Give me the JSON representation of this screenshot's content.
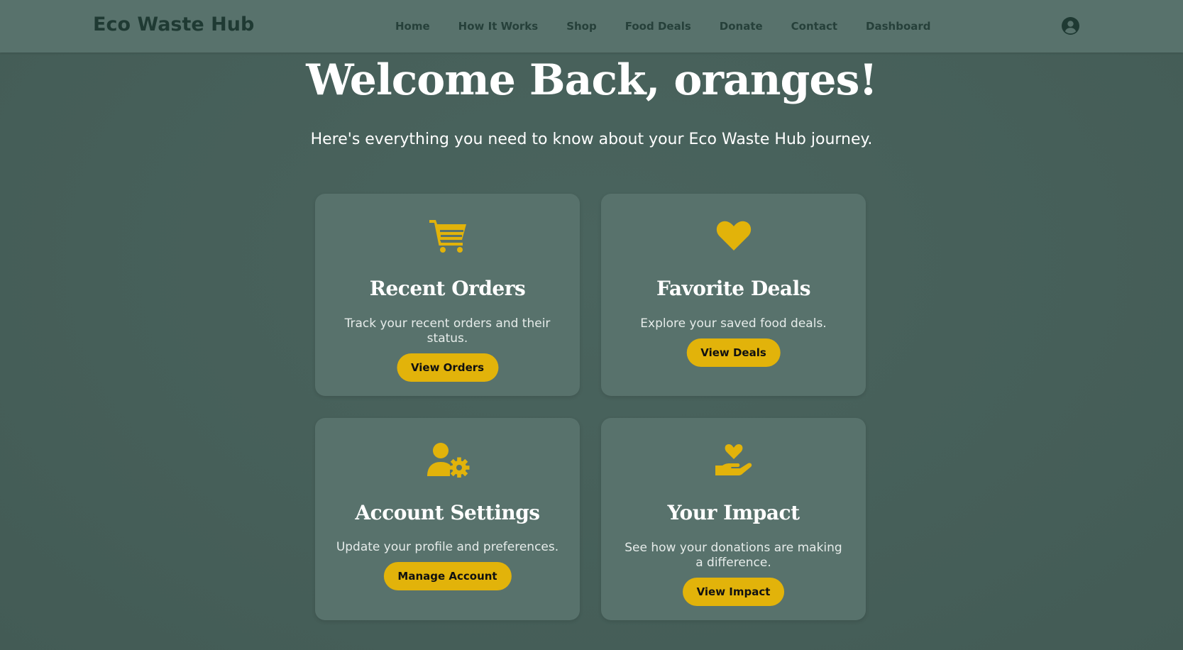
{
  "brand": {
    "name": "Eco Waste Hub"
  },
  "nav": {
    "items": [
      {
        "label": "Home"
      },
      {
        "label": "How It Works"
      },
      {
        "label": "Shop"
      },
      {
        "label": "Food Deals"
      },
      {
        "label": "Donate"
      },
      {
        "label": "Contact"
      },
      {
        "label": "Dashboard"
      }
    ],
    "user_icon": "user-circle-icon"
  },
  "hero": {
    "title": "Welcome Back, oranges!",
    "subtitle": "Here's everything you need to know about your Eco Waste Hub journey."
  },
  "cards": [
    {
      "icon": "shopping-cart-icon",
      "title": "Recent Orders",
      "description": "Track your recent orders and their status.",
      "button": "View Orders"
    },
    {
      "icon": "heart-icon",
      "title": "Favorite Deals",
      "description": "Explore your saved food deals.",
      "button": "View Deals"
    },
    {
      "icon": "user-gear-icon",
      "title": "Account Settings",
      "description": "Update your profile and preferences.",
      "button": "Manage Account"
    },
    {
      "icon": "hand-holding-heart-icon",
      "title": "Your Impact",
      "description": "See how your donations are making a difference.",
      "button": "View Impact"
    }
  ],
  "colors": {
    "background": "#465f59",
    "navbar": "#58726c",
    "card": "#58726c",
    "accent": "#e2b30a",
    "brand_text": "#1f3a33"
  }
}
